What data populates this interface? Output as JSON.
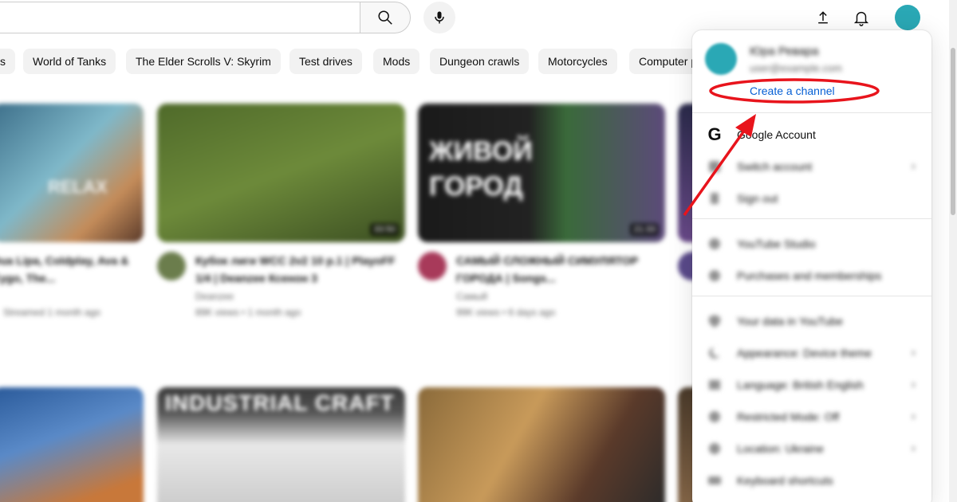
{
  "header": {
    "search_placeholder": "",
    "search_icon": "search-icon",
    "mic_icon": "microphone-icon",
    "upload_icon": "upload-icon",
    "notifications_icon": "bell-icon",
    "avatar_color": "#2aa8b5"
  },
  "chips": [
    {
      "label": "s"
    },
    {
      "label": "World of Tanks"
    },
    {
      "label": "The Elder Scrolls V: Skyrim"
    },
    {
      "label": "Test drives"
    },
    {
      "label": "Mods"
    },
    {
      "label": "Dungeon crawls"
    },
    {
      "label": "Motorcycles"
    },
    {
      "label": "Computer p"
    }
  ],
  "videos": [
    {
      "title": "Dua Lipa, Coldplay, Ava & Kygo, The...",
      "channel": "",
      "views": "Streamed 1 month ago",
      "thumb_text": "RELAX"
    },
    {
      "title": "Кубок лиги WCC 2v2 10 р.1 | PlayoFF 1/4 | Deanzee Ксенон 3",
      "channel": "Deanzee",
      "views": "89K views • 1 month ago",
      "thumb_text": "",
      "duration": "33:50"
    },
    {
      "title": "САМЫЙ СЛОЖНЫЙ СИМУЛЯТОР ГОРОДА | Songs...",
      "channel": "Самый",
      "views": "99K views • 6 days ago",
      "thumb_text": "ЖИВОЙ ГОРОД",
      "duration": "21:33"
    },
    {
      "title": "",
      "channel": "",
      "views": "",
      "thumb_text": "INDUSTRIAL CRAFT"
    }
  ],
  "menu": {
    "user_name": "Юра Ревара",
    "user_handle": "user@example.com",
    "create_channel": "Create a channel",
    "items": [
      {
        "label": "Google Account",
        "icon": "google-icon",
        "chevron": false,
        "blurred": false
      },
      {
        "label": "Switch account",
        "icon": "switch-account-icon",
        "chevron": true,
        "blurred": true
      },
      {
        "label": "Sign out",
        "icon": "sign-out-icon",
        "chevron": false,
        "blurred": true
      },
      {
        "label": "YouTube Studio",
        "icon": "studio-icon",
        "chevron": false,
        "blurred": true
      },
      {
        "label": "Purchases and memberships",
        "icon": "purchases-icon",
        "chevron": false,
        "blurred": true
      },
      {
        "label": "Your data in YouTube",
        "icon": "shield-icon",
        "chevron": false,
        "blurred": true
      },
      {
        "label": "Appearance: Device theme",
        "icon": "moon-icon",
        "chevron": true,
        "blurred": true
      },
      {
        "label": "Language: British English",
        "icon": "translate-icon",
        "chevron": true,
        "blurred": true
      },
      {
        "label": "Restricted Mode: Off",
        "icon": "restricted-icon",
        "chevron": true,
        "blurred": true
      },
      {
        "label": "Location: Ukraine",
        "icon": "globe-icon",
        "chevron": true,
        "blurred": true
      },
      {
        "label": "Keyboard shortcuts",
        "icon": "keyboard-icon",
        "chevron": false,
        "blurred": true
      }
    ]
  },
  "annotation": {
    "highlight_color": "#e8141c"
  }
}
